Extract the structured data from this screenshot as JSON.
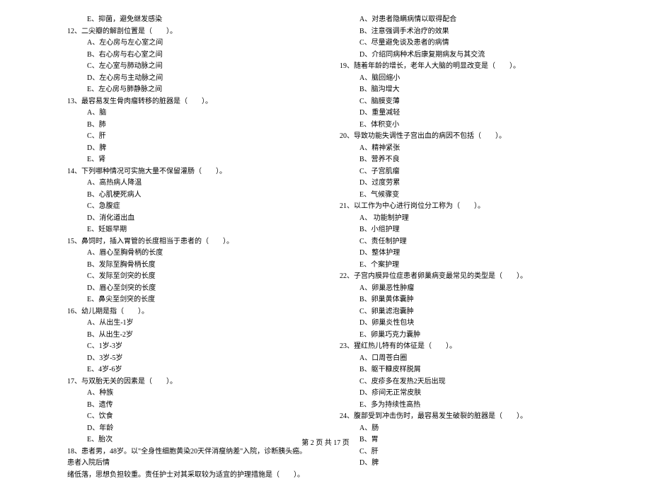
{
  "leftColumn": {
    "q11": {
      "e": "E、抑菌，避免继发感染"
    },
    "q12": {
      "stem": "12、二尖瓣的解剖位置是（　　）。",
      "a": "A、左心房与左心室之间",
      "b": "B、右心房与右心室之间",
      "c": "C、左心室与肺动脉之间",
      "d": "D、左心房与主动脉之间",
      "e": "E、左心房与肺静脉之间"
    },
    "q13": {
      "stem": "13、最容易发生骨肉瘤转移的脏器是（　　）。",
      "a": "A、脑",
      "b": "B、肺",
      "c": "C、肝",
      "d": "D、脾",
      "e": "E、肾"
    },
    "q14": {
      "stem": "14、下列哪种情况可实施大量不保留灌肠（　　）。",
      "a": "A、高热病人降温",
      "b": "B、心肌梗死病人",
      "c": "C、急腹症",
      "d": "D、消化道出血",
      "e": "E、妊娠早期"
    },
    "q15": {
      "stem": "15、鼻饲时，插入胃管的长度相当于患者的（　　）。",
      "a": "A、眉心至胸骨柄的长度",
      "b": "B、发际至胸骨柄长度",
      "c": "C、发际至剑突的长度",
      "d": "D、眉心至剑突的长度",
      "e": "E、鼻尖至剑突的长度"
    },
    "q16": {
      "stem": "16、幼儿期是指（　　）。",
      "a": "A、从出生-1岁",
      "b": "B、从出生-2岁",
      "c": "C、1岁-3岁",
      "d": "D、3岁-5岁",
      "e": "E、4岁-6岁"
    },
    "q17": {
      "stem": "17、与双胎无关的因素是（　　）。",
      "a": "A、种族",
      "b": "B、遗传",
      "c": "C、饮食",
      "d": "D、年龄",
      "e": "E、胎次"
    },
    "q18": {
      "stem1": "18、患者男，48岁。以\"全身性细胞黄染20天伴消瘦纳差\"入院，诊断胰头癌。患者入院后情",
      "stem2": "绪低落，思想负担较重。责任护士对其采取较为适宜的护理措施是（　　）。"
    }
  },
  "rightColumn": {
    "q18opts": {
      "a": "A、对患者隐瞒病情以取得配合",
      "b": "B、注意强调手术治疗的效果",
      "c": "C、尽量避免谈及患者的病情",
      "d": "D、介绍同病种术后康复期病友与其交流"
    },
    "q19": {
      "stem": "19、随着年龄的增长，老年人大脑的明显改变是（　　）。",
      "a": "A、脑回缩小",
      "b": "B、脑沟增大",
      "c": "C、脑膜变薄",
      "d": "D、重量减轻",
      "e": "E、体积变小"
    },
    "q20": {
      "stem": "20、导致功能失调性子宫出血的病因不包括（　　）。",
      "a": "A、精神紧张",
      "b": "B、营养不良",
      "c": "C、子宫肌瘤",
      "d": "D、过度劳累",
      "e": "E、气候骤变"
    },
    "q21": {
      "stem": "21、以工作为中心进行岗位分工称为（　　）。",
      "a": "A、 功能制护理",
      "b": "B、小组护理",
      "c": "C、责任制护理",
      "d": "D、整体护理",
      "e": "E、个案护理"
    },
    "q22": {
      "stem": "22、子宫内膜异位症患者卵巢病变最常见的类型是（　　）。",
      "a": "A、卵巢恶性肿瘤",
      "b": "B、卵巢黄体囊肿",
      "c": "C、卵巢滤泡囊肿",
      "d": "D、卵巢炎性包块",
      "e": "E、卵巢巧克力囊肿"
    },
    "q23": {
      "stem": "23、猩红热儿特有的体征是（　　）。",
      "a": "A、口周苍白圈",
      "b": "B、躯干糠皮样脱屑",
      "c": "C、皮疹多在发热2天后出现",
      "d": "D、疹间无正常皮肤",
      "e": "E、多为持续性高热"
    },
    "q24": {
      "stem": "24、腹部受到冲击伤时，最容易发生破裂的脏器是（　　）。",
      "a": "A、肠",
      "b": "B、胃",
      "c": "C、肝",
      "d": "D、脾"
    }
  },
  "footer": "第 2 页 共 17 页"
}
